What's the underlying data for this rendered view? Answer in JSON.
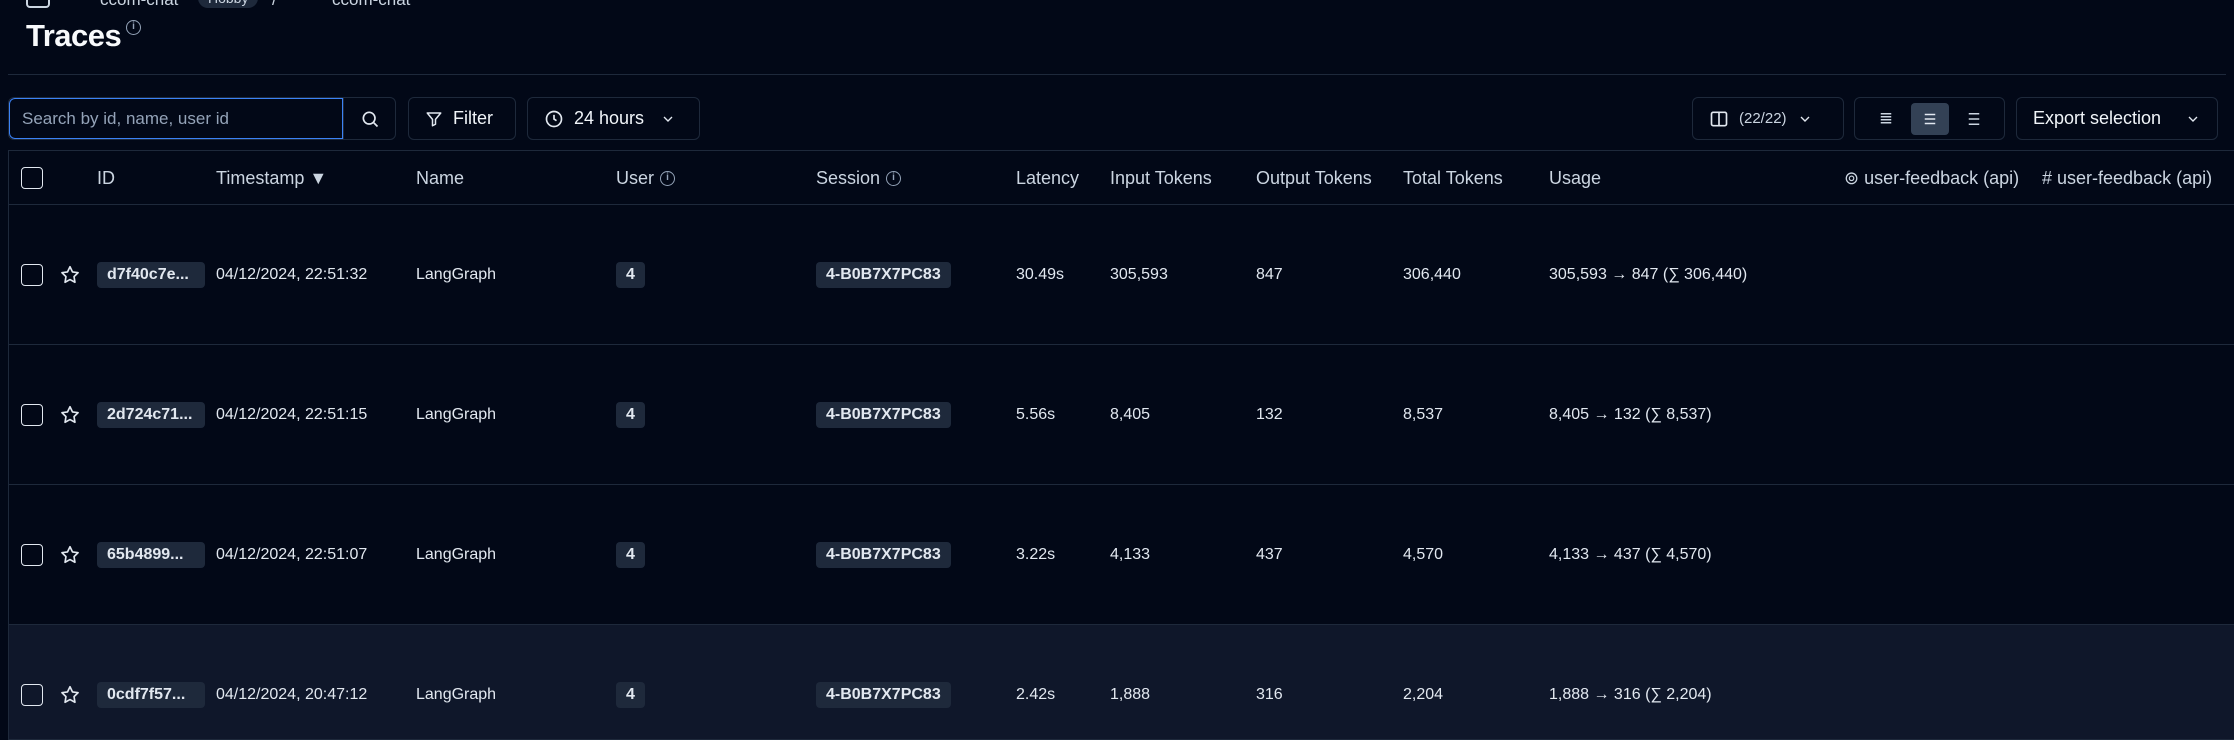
{
  "breadcrumb": {
    "project": "ccom-chat",
    "env_badge": "Hobby",
    "page": "ccom-chat"
  },
  "page": {
    "title": "Traces",
    "info_symbol": "i"
  },
  "toolbar": {
    "search_placeholder": "Search by id, name, user id",
    "search_value": "",
    "filter_label": "Filter",
    "time_range": "24 hours",
    "columns_count": "(22/22)",
    "export_label": "Export selection",
    "row_density_selected": "comfortable"
  },
  "table": {
    "headers": {
      "id": "ID",
      "timestamp": "Timestamp ▼",
      "name": "Name",
      "user": "User",
      "session": "Session",
      "latency": "Latency",
      "input_tokens": "Input Tokens",
      "output_tokens": "Output Tokens",
      "total_tokens": "Total Tokens",
      "usage": "Usage",
      "feedback_cat": "⊚ user-feedback (api)",
      "feedback_num": "# user-feedback (api)"
    },
    "rows": [
      {
        "id": "d7f40c7e...",
        "timestamp": "04/12/2024, 22:51:32",
        "name": "LangGraph",
        "user": "4",
        "session": "4-B0B7X7PC83",
        "latency": "30.49s",
        "input_tokens": "305,593",
        "output_tokens": "847",
        "total_tokens": "306,440",
        "usage": "305,593 → 847 (∑ 306,440)"
      },
      {
        "id": "2d724c71...",
        "timestamp": "04/12/2024, 22:51:15",
        "name": "LangGraph",
        "user": "4",
        "session": "4-B0B7X7PC83",
        "latency": "5.56s",
        "input_tokens": "8,405",
        "output_tokens": "132",
        "total_tokens": "8,537",
        "usage": "8,405 → 132 (∑ 8,537)"
      },
      {
        "id": "65b4899...",
        "timestamp": "04/12/2024, 22:51:07",
        "name": "LangGraph",
        "user": "4",
        "session": "4-B0B7X7PC83",
        "latency": "3.22s",
        "input_tokens": "4,133",
        "output_tokens": "437",
        "total_tokens": "4,570",
        "usage": "4,133 → 437 (∑ 4,570)"
      },
      {
        "id": "0cdf7f57...",
        "timestamp": "04/12/2024, 20:47:12",
        "name": "LangGraph",
        "user": "4",
        "session": "4-B0B7X7PC83",
        "latency": "2.42s",
        "input_tokens": "1,888",
        "output_tokens": "316",
        "total_tokens": "2,204",
        "usage": "1,888 → 316 (∑ 2,204)"
      }
    ]
  },
  "icons": {
    "sidebar_toggle": "sidebar-icon",
    "search": "search-icon",
    "filter": "filter-icon",
    "clock": "clock-icon",
    "columns": "columns-icon",
    "star": "star-icon",
    "chevron": "chevron-down-icon"
  },
  "colors": {
    "background": "#020817",
    "border": "#1e293b",
    "focus": "#3b82f6",
    "pill": "#1e293b",
    "highlight_row": "#0f172a"
  }
}
